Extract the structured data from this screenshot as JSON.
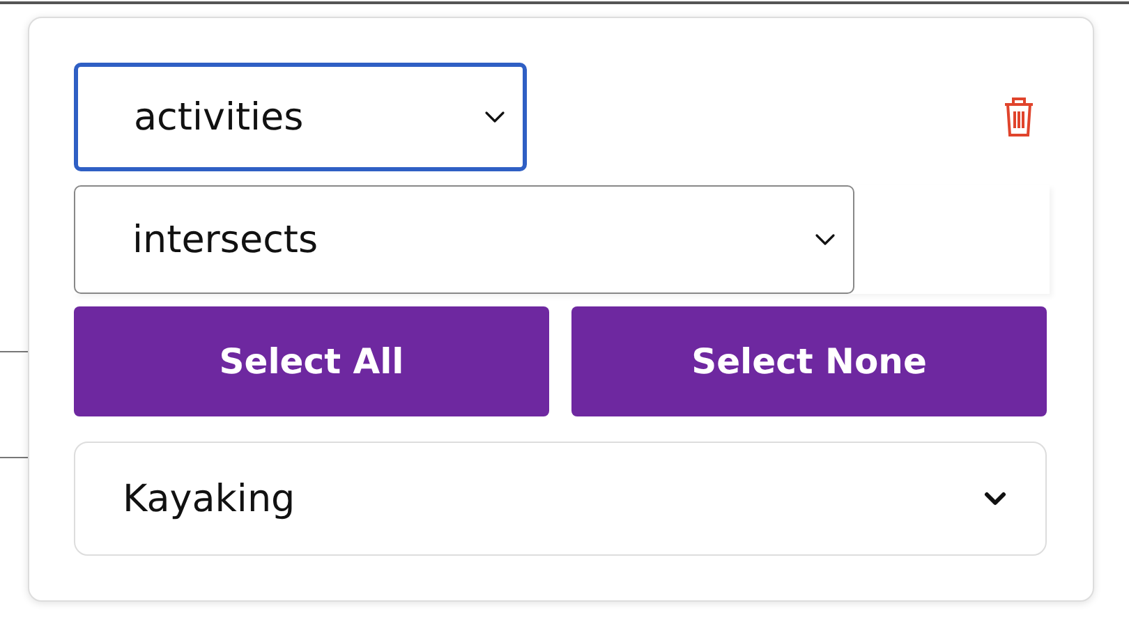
{
  "field_select": {
    "value": "activities",
    "focused": true
  },
  "operator_select": {
    "value": "intersects"
  },
  "buttons": [
    {
      "label": "Select All"
    },
    {
      "label": "Select None"
    }
  ],
  "value_dropdown": {
    "value": "Kayaking"
  }
}
